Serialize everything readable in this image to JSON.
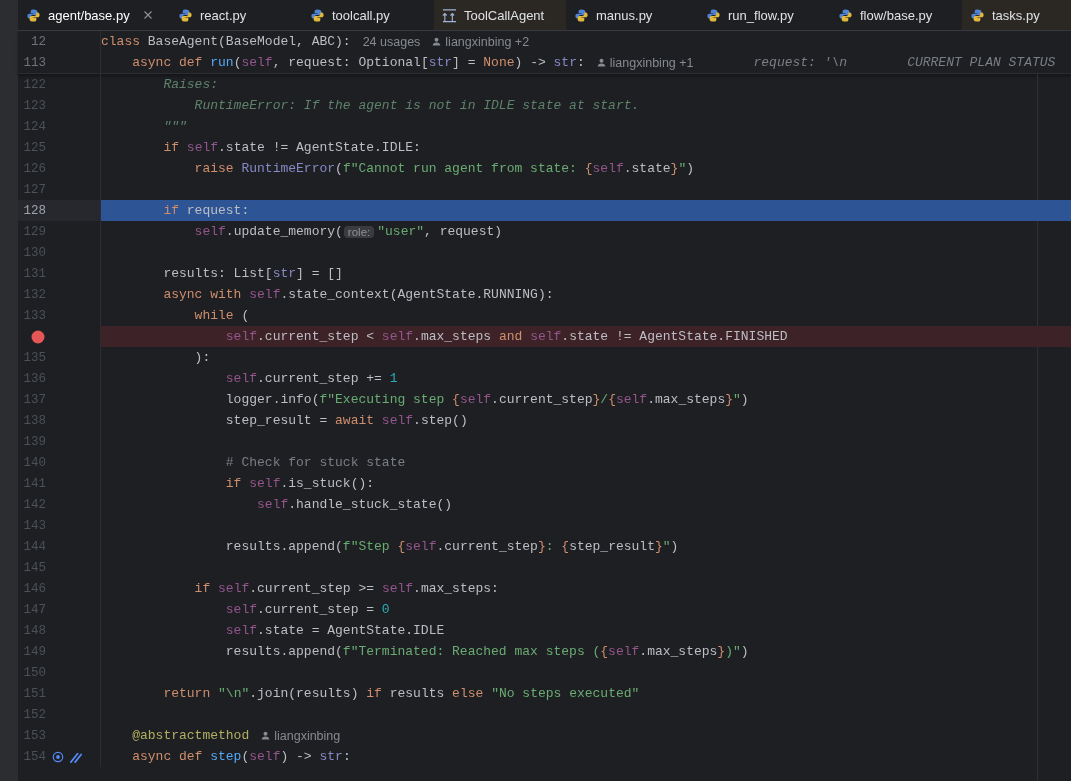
{
  "tabs": [
    {
      "label": "agent/base.py",
      "kind": "file",
      "selected": true,
      "highlighted": false,
      "closable": true
    },
    {
      "label": "react.py",
      "kind": "file",
      "selected": false,
      "highlighted": false,
      "closable": false
    },
    {
      "label": "toolcall.py",
      "kind": "file",
      "selected": false,
      "highlighted": false,
      "closable": false
    },
    {
      "label": "ToolCallAgent",
      "kind": "class",
      "selected": false,
      "highlighted": true,
      "closable": false
    },
    {
      "label": "manus.py",
      "kind": "file",
      "selected": false,
      "highlighted": false,
      "closable": false
    },
    {
      "label": "run_flow.py",
      "kind": "file",
      "selected": false,
      "highlighted": false,
      "closable": false
    },
    {
      "label": "flow/base.py",
      "kind": "file",
      "selected": false,
      "highlighted": false,
      "closable": false
    },
    {
      "label": "tasks.py",
      "kind": "file",
      "selected": false,
      "highlighted": true,
      "closable": false
    }
  ],
  "sticky": [
    {
      "number": "12",
      "segments": [
        {
          "kind": "code",
          "tokens": [
            {
              "t": "class",
              "kind": "keyword"
            },
            {
              "t": " BaseAgent(BaseModel, ABC):"
            }
          ]
        },
        {
          "kind": "meta",
          "text": "24 usages"
        },
        {
          "kind": "author",
          "text": "liangxinbing +2"
        }
      ]
    },
    {
      "number": "113",
      "segments": [
        {
          "kind": "code",
          "tokens": [
            {
              "t": "    async def ",
              "kind": "keyword"
            },
            {
              "t": "run",
              "kind": "function"
            },
            {
              "t": "("
            },
            {
              "t": "self",
              "kind": "self"
            },
            {
              "t": ", request: Optional["
            },
            {
              "t": "str",
              "kind": "builtin"
            },
            {
              "t": "] = "
            },
            {
              "t": "None",
              "kind": "keyword"
            },
            {
              "t": ") -> "
            },
            {
              "t": "str",
              "kind": "builtin"
            },
            {
              "t": ":"
            }
          ]
        },
        {
          "kind": "author",
          "text": "liangxinbing +1"
        },
        {
          "kind": "debug",
          "text": "request: '\\n"
        },
        {
          "kind": "debug",
          "text": "CURRENT PLAN STATUS"
        }
      ]
    }
  ],
  "lines": [
    {
      "number": "122",
      "segments": [
        {
          "kind": "code",
          "tokens": [
            {
              "t": "        Raises:",
              "kind": "docstring"
            }
          ]
        }
      ]
    },
    {
      "number": "123",
      "segments": [
        {
          "kind": "code",
          "tokens": [
            {
              "t": "            RuntimeError: If the agent is not in IDLE state at start.",
              "kind": "docstring"
            }
          ]
        }
      ]
    },
    {
      "number": "124",
      "segments": [
        {
          "kind": "code",
          "tokens": [
            {
              "t": "        \"\"\"",
              "kind": "docstring"
            }
          ]
        }
      ]
    },
    {
      "number": "125",
      "segments": [
        {
          "kind": "code",
          "tokens": [
            {
              "t": "        if ",
              "kind": "keyword"
            },
            {
              "t": "self",
              "kind": "self"
            },
            {
              "t": ".state != AgentState.IDLE:"
            }
          ]
        }
      ]
    },
    {
      "number": "126",
      "segments": [
        {
          "kind": "code",
          "tokens": [
            {
              "t": "            raise ",
              "kind": "keyword"
            },
            {
              "t": "RuntimeError",
              "kind": "builtin"
            },
            {
              "t": "("
            },
            {
              "t": "f\"Cannot run agent from state: ",
              "kind": "string"
            },
            {
              "t": "{",
              "kind": "keyword"
            },
            {
              "t": "self",
              "kind": "self"
            },
            {
              "t": ".state"
            },
            {
              "t": "}",
              "kind": "keyword"
            },
            {
              "t": "\"",
              "kind": "string"
            },
            {
              "t": ")"
            }
          ]
        }
      ]
    },
    {
      "number": "127"
    },
    {
      "number": "128",
      "current": true,
      "segments": [
        {
          "kind": "code",
          "tokens": [
            {
              "t": "        if",
              "kind": "keyword"
            },
            {
              "t": " request:"
            }
          ]
        }
      ]
    },
    {
      "number": "129",
      "segments": [
        {
          "kind": "code",
          "tokens": [
            {
              "t": "            self",
              "kind": "self"
            },
            {
              "t": ".update_memory("
            }
          ]
        },
        {
          "kind": "inlay",
          "text": "role:"
        },
        {
          "kind": "code",
          "tokens": [
            {
              "t": "\"user\"",
              "kind": "string"
            },
            {
              "t": ", request)"
            }
          ]
        }
      ]
    },
    {
      "number": "130"
    },
    {
      "number": "131",
      "segments": [
        {
          "kind": "code",
          "tokens": [
            {
              "t": "        results: List["
            },
            {
              "t": "str",
              "kind": "builtin"
            },
            {
              "t": "] = []"
            }
          ]
        }
      ]
    },
    {
      "number": "132",
      "segments": [
        {
          "kind": "code",
          "tokens": [
            {
              "t": "        async with ",
              "kind": "keyword"
            },
            {
              "t": "self",
              "kind": "self"
            },
            {
              "t": ".state_context(AgentState.RUNNING):"
            }
          ]
        }
      ]
    },
    {
      "number": "133",
      "segments": [
        {
          "kind": "code",
          "tokens": [
            {
              "t": "            while",
              "kind": "keyword"
            },
            {
              "t": " ("
            }
          ]
        }
      ]
    },
    {
      "breakpoint": true,
      "segments": [
        {
          "kind": "code",
          "tokens": [
            {
              "t": "                self",
              "kind": "self"
            },
            {
              "t": ".current_step < "
            },
            {
              "t": "self",
              "kind": "self"
            },
            {
              "t": ".max_steps "
            },
            {
              "t": "and ",
              "kind": "keyword"
            },
            {
              "t": "self",
              "kind": "self"
            },
            {
              "t": ".state != AgentState.FINISHED"
            }
          ]
        }
      ]
    },
    {
      "number": "135",
      "segments": [
        {
          "kind": "code",
          "tokens": [
            {
              "t": "            ):"
            }
          ]
        }
      ]
    },
    {
      "number": "136",
      "segments": [
        {
          "kind": "code",
          "tokens": [
            {
              "t": "                self",
              "kind": "self"
            },
            {
              "t": ".current_step += "
            },
            {
              "t": "1",
              "kind": "number"
            }
          ]
        }
      ]
    },
    {
      "number": "137",
      "segments": [
        {
          "kind": "code",
          "tokens": [
            {
              "t": "                logger.info("
            },
            {
              "t": "f\"Executing step ",
              "kind": "string"
            },
            {
              "t": "{",
              "kind": "keyword"
            },
            {
              "t": "self",
              "kind": "self"
            },
            {
              "t": ".current_step"
            },
            {
              "t": "}",
              "kind": "keyword"
            },
            {
              "t": "/",
              "kind": "string"
            },
            {
              "t": "{",
              "kind": "keyword"
            },
            {
              "t": "self",
              "kind": "self"
            },
            {
              "t": ".max_steps"
            },
            {
              "t": "}",
              "kind": "keyword"
            },
            {
              "t": "\"",
              "kind": "string"
            },
            {
              "t": ")"
            }
          ]
        }
      ]
    },
    {
      "number": "138",
      "segments": [
        {
          "kind": "code",
          "tokens": [
            {
              "t": "                step_result = "
            },
            {
              "t": "await ",
              "kind": "keyword"
            },
            {
              "t": "self",
              "kind": "self"
            },
            {
              "t": ".step()"
            }
          ]
        }
      ]
    },
    {
      "number": "139"
    },
    {
      "number": "140",
      "segments": [
        {
          "kind": "code",
          "tokens": [
            {
              "t": "                # Check for stuck state",
              "kind": "comment"
            }
          ]
        }
      ]
    },
    {
      "number": "141",
      "segments": [
        {
          "kind": "code",
          "tokens": [
            {
              "t": "                if ",
              "kind": "keyword"
            },
            {
              "t": "self",
              "kind": "self"
            },
            {
              "t": ".is_stuck():"
            }
          ]
        }
      ]
    },
    {
      "number": "142",
      "segments": [
        {
          "kind": "code",
          "tokens": [
            {
              "t": "                    self",
              "kind": "self"
            },
            {
              "t": ".handle_stuck_state()"
            }
          ]
        }
      ]
    },
    {
      "number": "143"
    },
    {
      "number": "144",
      "segments": [
        {
          "kind": "code",
          "tokens": [
            {
              "t": "                results.append("
            },
            {
              "t": "f\"Step ",
              "kind": "string"
            },
            {
              "t": "{",
              "kind": "keyword"
            },
            {
              "t": "self",
              "kind": "self"
            },
            {
              "t": ".current_step"
            },
            {
              "t": "}",
              "kind": "keyword"
            },
            {
              "t": ": ",
              "kind": "string"
            },
            {
              "t": "{",
              "kind": "keyword"
            },
            {
              "t": "step_result"
            },
            {
              "t": "}",
              "kind": "keyword"
            },
            {
              "t": "\"",
              "kind": "string"
            },
            {
              "t": ")"
            }
          ]
        }
      ]
    },
    {
      "number": "145"
    },
    {
      "number": "146",
      "segments": [
        {
          "kind": "code",
          "tokens": [
            {
              "t": "            if ",
              "kind": "keyword"
            },
            {
              "t": "self",
              "kind": "self"
            },
            {
              "t": ".current_step >= "
            },
            {
              "t": "self",
              "kind": "self"
            },
            {
              "t": ".max_steps:"
            }
          ]
        }
      ]
    },
    {
      "number": "147",
      "segments": [
        {
          "kind": "code",
          "tokens": [
            {
              "t": "                self",
              "kind": "self"
            },
            {
              "t": ".current_step = "
            },
            {
              "t": "0",
              "kind": "number"
            }
          ]
        }
      ]
    },
    {
      "number": "148",
      "segments": [
        {
          "kind": "code",
          "tokens": [
            {
              "t": "                self",
              "kind": "self"
            },
            {
              "t": ".state = AgentState.IDLE"
            }
          ]
        }
      ]
    },
    {
      "number": "149",
      "segments": [
        {
          "kind": "code",
          "tokens": [
            {
              "t": "                results.append("
            },
            {
              "t": "f\"Terminated: Reached max steps (",
              "kind": "string"
            },
            {
              "t": "{",
              "kind": "keyword"
            },
            {
              "t": "self",
              "kind": "self"
            },
            {
              "t": ".max_steps"
            },
            {
              "t": "}",
              "kind": "keyword"
            },
            {
              "t": ")\"",
              "kind": "string"
            },
            {
              "t": ")"
            }
          ]
        }
      ]
    },
    {
      "number": "150"
    },
    {
      "number": "151",
      "segments": [
        {
          "kind": "code",
          "tokens": [
            {
              "t": "        return ",
              "kind": "keyword"
            },
            {
              "t": "\"\\n\"",
              "kind": "string"
            },
            {
              "t": ".join(results) "
            },
            {
              "t": "if",
              "kind": "keyword"
            },
            {
              "t": " results "
            },
            {
              "t": "else ",
              "kind": "keyword"
            },
            {
              "t": "\"No steps executed\"",
              "kind": "string"
            }
          ]
        }
      ]
    },
    {
      "number": "152"
    },
    {
      "number": "153",
      "segments": [
        {
          "kind": "code",
          "tokens": [
            {
              "t": "    @abstractmethod",
              "kind": "decorator"
            }
          ]
        },
        {
          "kind": "author",
          "text": "liangxinbing"
        }
      ]
    },
    {
      "number": "154",
      "implemented": true,
      "ai_edited": true,
      "segments": [
        {
          "kind": "code",
          "tokens": [
            {
              "t": "    async def ",
              "kind": "keyword"
            },
            {
              "t": "step",
              "kind": "function"
            },
            {
              "t": "("
            },
            {
              "t": "self",
              "kind": "self"
            },
            {
              "t": ") -> "
            },
            {
              "t": "str",
              "kind": "builtin"
            },
            {
              "t": ":"
            }
          ]
        }
      ]
    }
  ]
}
